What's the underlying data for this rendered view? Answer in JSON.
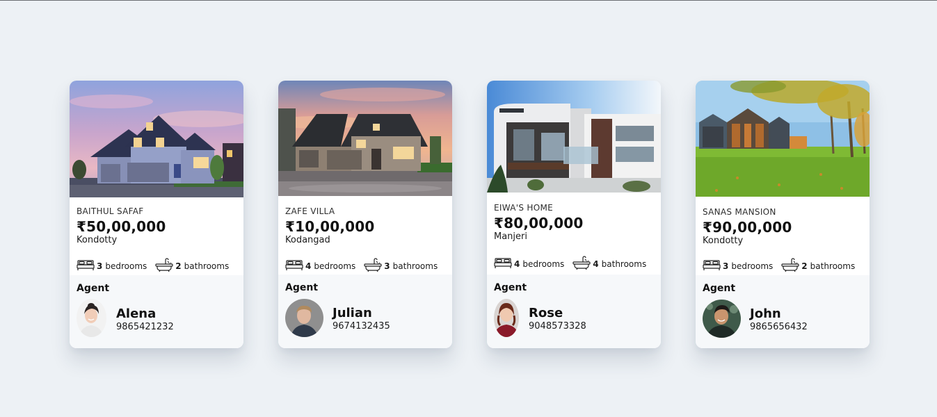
{
  "listings": [
    {
      "name": "BAITHUL SAFAF",
      "price": "₹50,00,000",
      "location": "Kondotty",
      "bedrooms": "3",
      "bedrooms_label": "bedrooms",
      "bathrooms": "2",
      "bathrooms_label": "bathrooms",
      "agent_heading": "Agent",
      "agent_name": "Alena",
      "agent_phone": "9865421232"
    },
    {
      "name": "ZAFE VILLA",
      "price": "₹10,00,000",
      "location": "Kodangad",
      "bedrooms": "4",
      "bedrooms_label": "bedrooms",
      "bathrooms": "3",
      "bathrooms_label": "bathrooms",
      "agent_heading": "Agent",
      "agent_name": "Julian",
      "agent_phone": "9674132435"
    },
    {
      "name": "EIWA'S HOME",
      "price": "₹80,00,000",
      "location": "Manjeri",
      "bedrooms": "4",
      "bedrooms_label": "bedrooms",
      "bathrooms": "4",
      "bathrooms_label": "bathrooms",
      "agent_heading": "Agent",
      "agent_name": "Rose",
      "agent_phone": "9048573328"
    },
    {
      "name": "SANAS MANSION",
      "price": "₹90,00,000",
      "location": "Kondotty",
      "bedrooms": "3",
      "bedrooms_label": "bedrooms",
      "bathrooms": "2",
      "bathrooms_label": "bathrooms",
      "agent_heading": "Agent",
      "agent_name": "John",
      "agent_phone": "9865656432"
    }
  ],
  "icons": {
    "bed": "bed-icon",
    "bath": "bathtub-icon"
  },
  "colors": {
    "page_background": "#edf1f5",
    "card_background": "#ffffff",
    "agent_panel_background": "#f6f8fa"
  }
}
